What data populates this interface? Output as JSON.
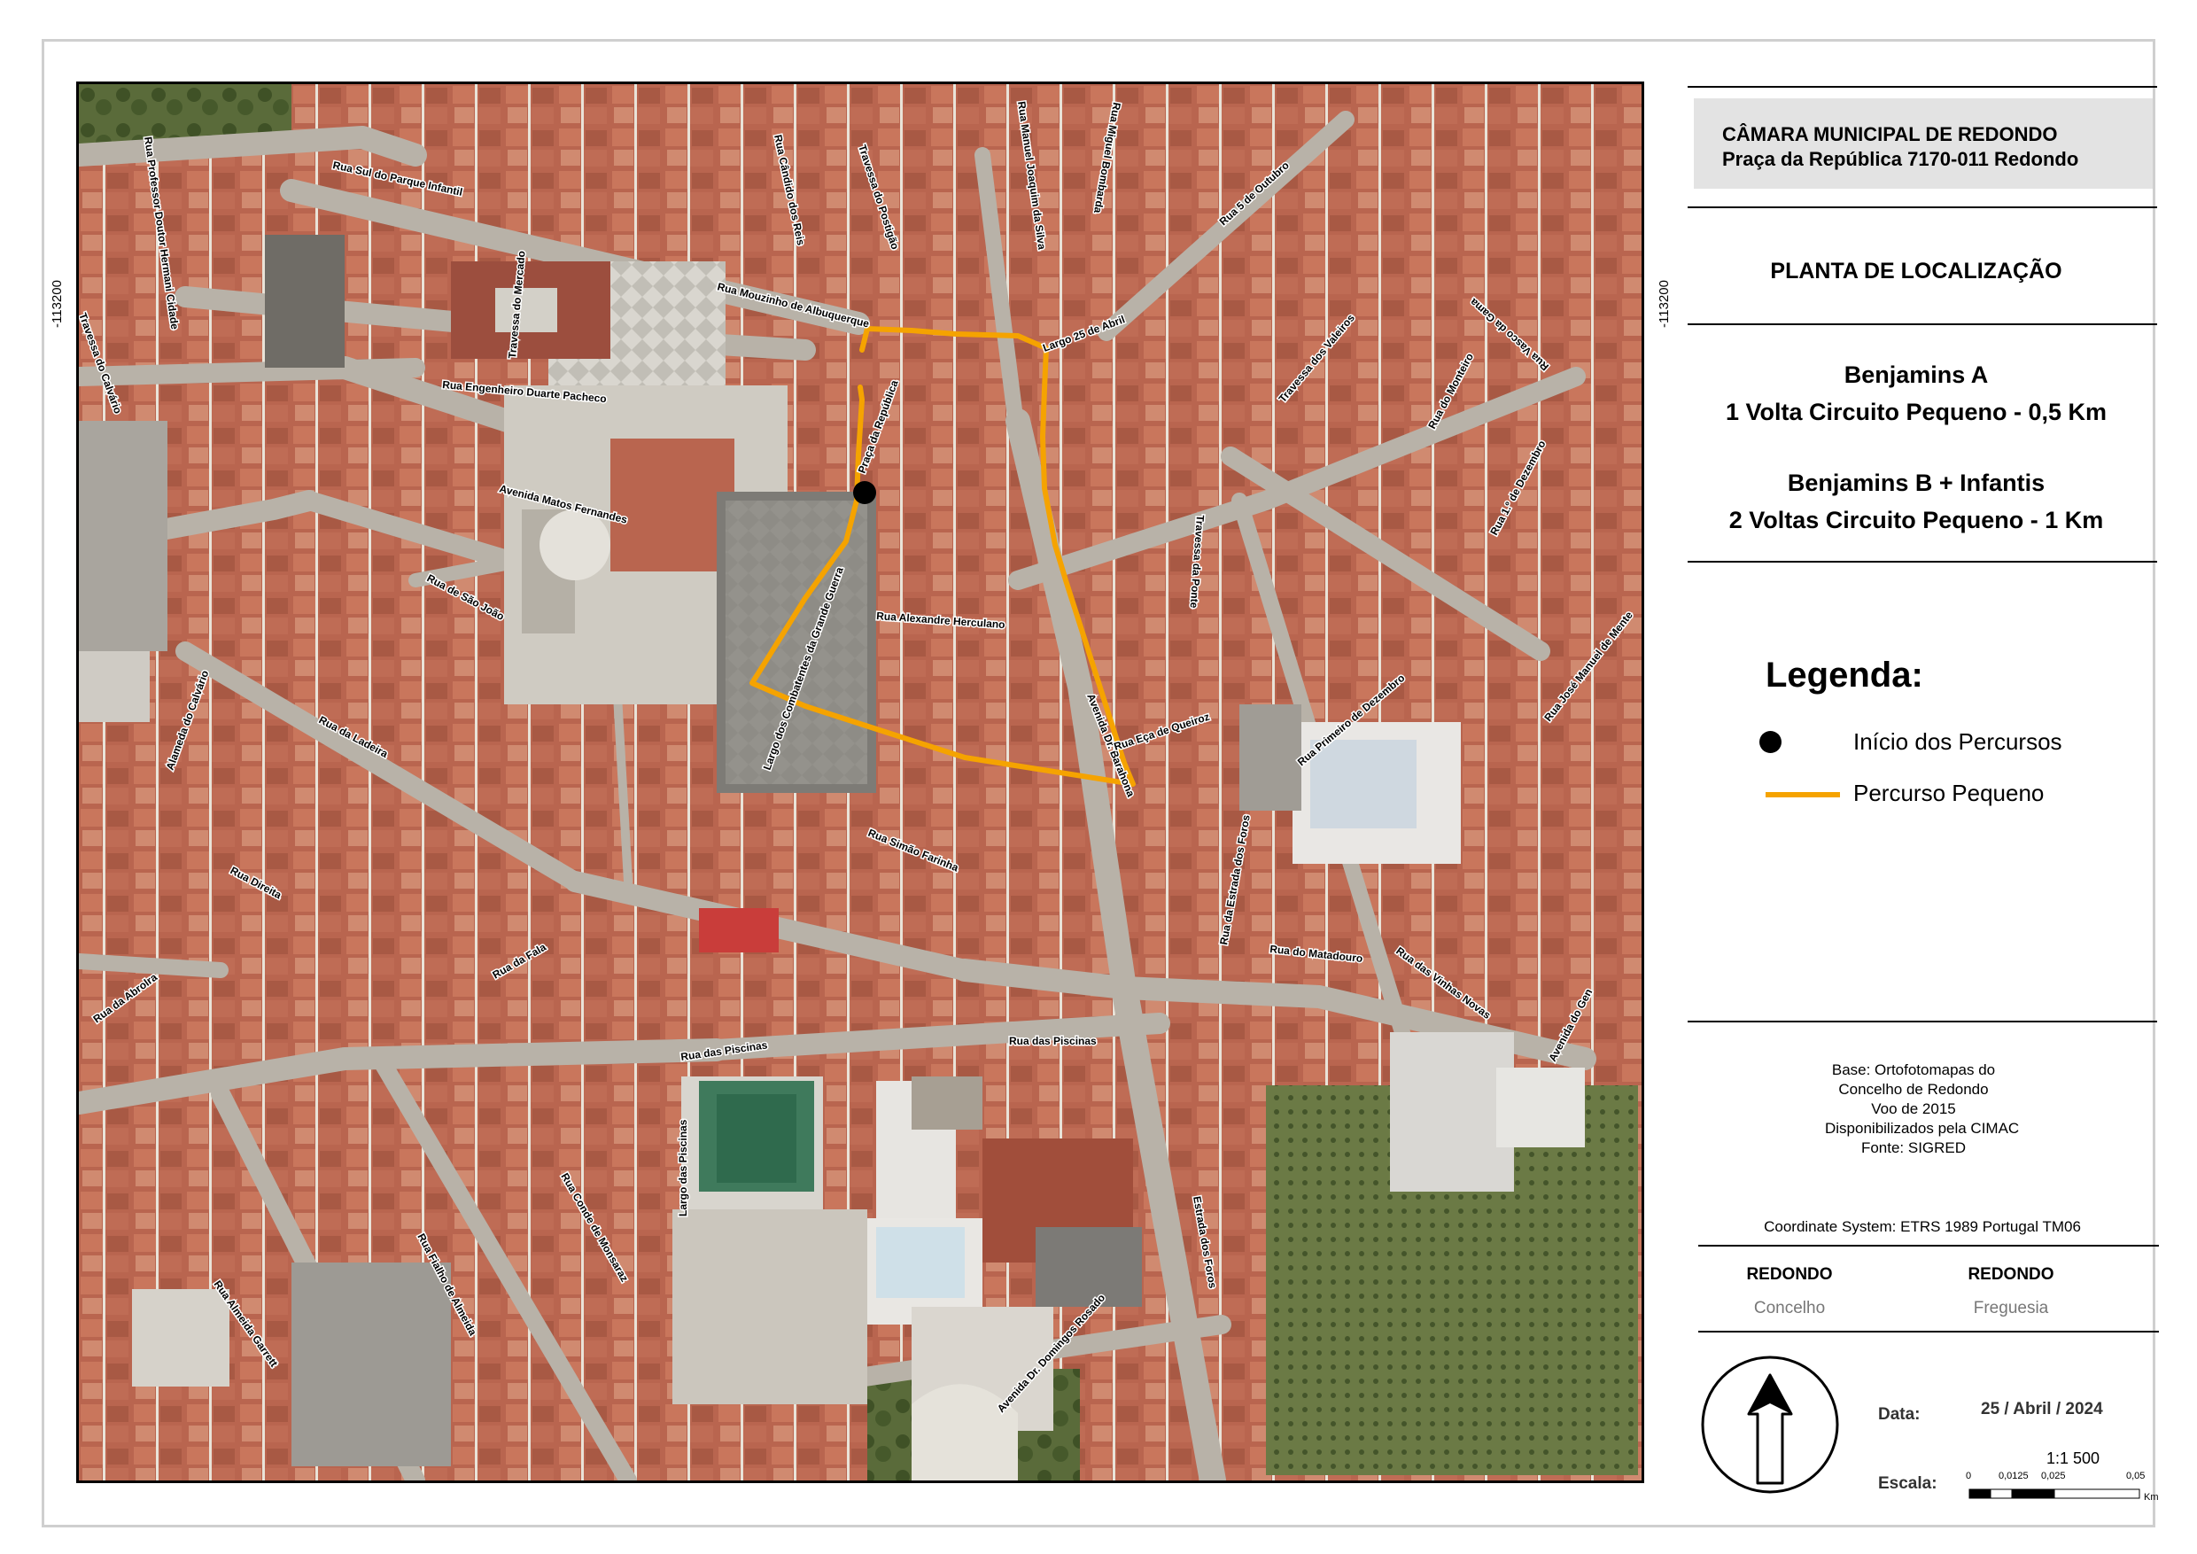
{
  "header": {
    "line1": "CÂMARA MUNICIPAL DE REDONDO",
    "line2": "Praça da República 7170-011 Redondo"
  },
  "title": "PLANTA DE LOCALIZAÇÃO",
  "routes": [
    {
      "name": "Benjamins A",
      "detail": "1 Volta Circuito Pequeno - 0,5 Km"
    },
    {
      "name": "Benjamins B + Infantis",
      "detail": "2 Voltas Circuito Pequeno - 1 Km"
    }
  ],
  "legend": {
    "title": "Legenda:",
    "items": [
      {
        "label": "Início dos Percursos",
        "symbol": "black-dot"
      },
      {
        "label": "Percurso Pequeno",
        "symbol": "orange-line",
        "color": "#F5A300"
      }
    ]
  },
  "source": {
    "lines": [
      "Base: Ortofotomapas do",
      "Concelho de Redondo",
      "Voo de 2015",
      "Disponibilizados pela CIMAC",
      "Fonte: SIGRED"
    ]
  },
  "coordinate_system": "Coordinate System: ETRS 1989 Portugal TM06",
  "admin": {
    "concelho_value": "REDONDO",
    "concelho_label": "Concelho",
    "freguesia_value": "REDONDO",
    "freguesia_label": "Freguesia"
  },
  "date": {
    "label": "Data:",
    "value": "25 / Abril / 2024"
  },
  "scale": {
    "label": "Escala:",
    "ratio": "1:1 500",
    "ticks": [
      "0",
      "0,0125",
      "0,025",
      "0,05"
    ],
    "unit": "Km"
  },
  "grid_coord": "-113200",
  "map": {
    "route_color": "#F5A300",
    "streets": [
      "Rua Professor Doutor Hermani Cidade",
      "Rua Sul do Parque Infantil",
      "Rua Cândido dos Reis",
      "Travessa do Postigão",
      "Rua Manuel Joaquim da Silva",
      "Rua Miguel Bombarda",
      "Rua 5 de Outubro",
      "Travessa do Mercado",
      "Travessa do Calvário",
      "Rua Mouzinho de Albuquerque",
      "Largo 25 de Abril",
      "Rua Engenheiro Duarte Pacheco",
      "Praça da República",
      "Avenida Matos Fernandes",
      "Travessa dos Valeiros",
      "Rua Vasco da Gama",
      "Rua do Monteiro",
      "Rua 1.º de Dezembro",
      "Rua de São João",
      "Travessa da Ponte",
      "Rua Alexandre Herculano",
      "Largo dos Combatentes da Grande Guerra",
      "Alameda do Calvário",
      "Rua da Ladeira",
      "Avenida Dr. Barahona",
      "Rua Eça de Queiroz",
      "Rua Primeiro de Dezembro",
      "Rua José Manuel de Mente",
      "Rua Simão Farinha",
      "Rua Direita",
      "Rua da Fala",
      "Rua da Estrada dos Foros",
      "Rua do Matadouro",
      "Rua das Vinhas Novas",
      "Avenida do Gen",
      "Rua da Abrolra",
      "Rua das Piscinas",
      "Largo das Piscinas",
      "Rua Conde de Monsaraz",
      "Rua Fialho de Almeida",
      "Rua Almeida Garrett",
      "Avenida Dr. Domingos Rosado",
      "Estrada dos Foros"
    ]
  }
}
